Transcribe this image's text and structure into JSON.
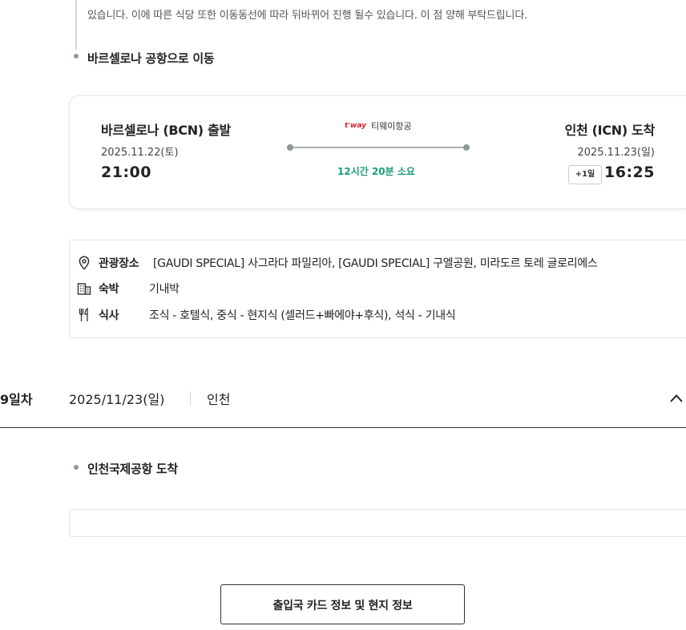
{
  "notice": {
    "text": "있습니다. 이에 따른 식당 또한 이동동선에 따라 뒤바뀌어 진행 될수 있습니다. 이 점 양해 부탁드립니다."
  },
  "steps": {
    "barcelona_airport": "바르셀로나 공항으로 이동",
    "incheon_arrival": "인천국제공항 도착"
  },
  "flight": {
    "departure": {
      "title": "바르셀로나 (BCN) 출발",
      "date": "2025.11.22(토)",
      "time": "21:00"
    },
    "airline": {
      "logo_text": "t'way",
      "name": "티웨이항공"
    },
    "duration": "12시간 20분 소요",
    "arrival": {
      "title": "인천 (ICN) 도착",
      "date": "2025.11.23(일)",
      "plus_day": "+1일",
      "time": "16:25"
    }
  },
  "day_info": {
    "sightseeing": {
      "label": "관광장소",
      "value": "[GAUDI SPECIAL] 사그라다 파밀리아, [GAUDI SPECIAL] 구엘공원, 미라도르 토레 글로리에스",
      "icon": "location-pin-icon"
    },
    "lodging": {
      "label": "숙박",
      "value": "기내박",
      "icon": "building-icon"
    },
    "meals": {
      "label": "식사",
      "value": "조식 - 호텔식, 중식 - 현지식 (셀러드+빠에야+후식), 석식 - 기내식",
      "icon": "fork-knife-icon"
    }
  },
  "day9": {
    "label": "9일차",
    "date": "2025/11/23(일)",
    "city": "인천",
    "toggle_icon": "chevron-up-icon"
  },
  "actions": {
    "info_button": "출입국 카드 정보 및 현지 정보"
  },
  "colors": {
    "accent_green": "#1a9c7a",
    "airline_red": "#d8202a",
    "dot_gray": "#8c9c96"
  }
}
